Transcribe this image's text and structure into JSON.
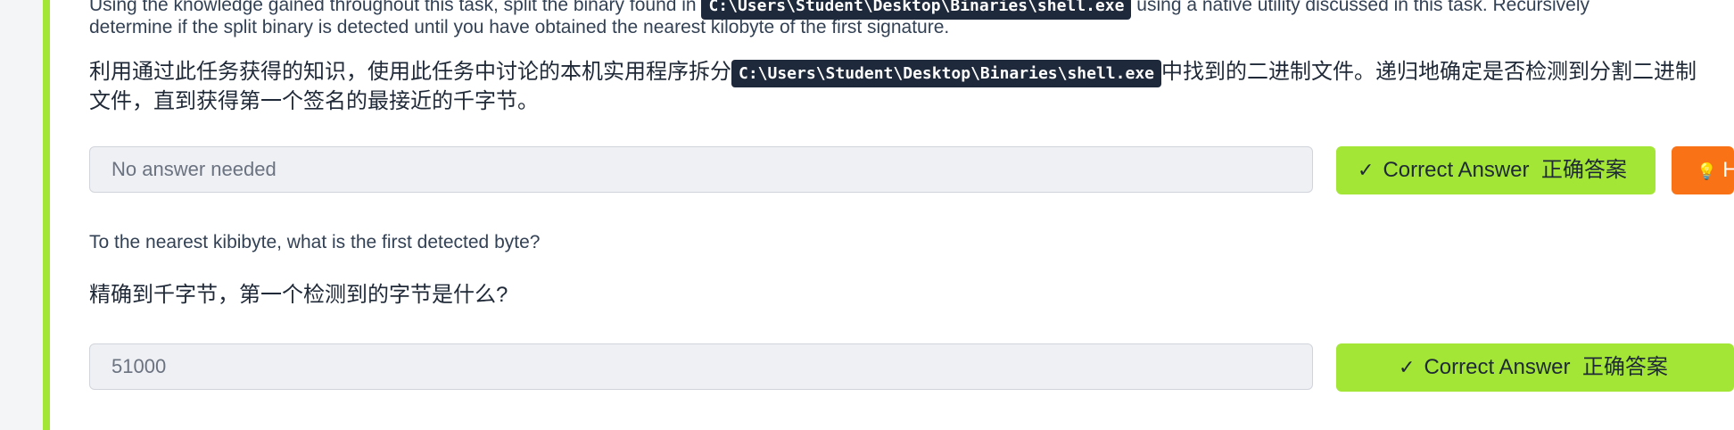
{
  "question1": {
    "text_en_line1_before": "Using the knowledge gained throughout this task, split the binary found in",
    "code": "C:\\Users\\Student\\Desktop\\Binaries\\shell.exe",
    "text_en_line1_after": "using a native utility discussed in this task. Recursively",
    "text_en_line2": "determine if the split binary is detected until you have obtained the nearest kilobyte of the first signature.",
    "text_cn_line1_before": "利用通过此任务获得的知识，使用此任务中讨论的本机实用程序拆分",
    "text_cn_line1_after": "中找到的二进制文件。递归地确定是否检测到分割二进制",
    "text_cn_line2": "文件，直到获得第一个签名的最接近的千字节。",
    "answer_placeholder": "No answer needed",
    "button_label_en": "Correct Answer",
    "button_label_cn": "正确答案",
    "hint_label": "H"
  },
  "question2": {
    "text_en": "To the nearest kibibyte, what is the first detected byte?",
    "text_cn": "精确到千字节，第一个检测到的字节是什么?",
    "answer_value": "51000",
    "button_label_en": "Correct Answer",
    "button_label_cn": "正确答案"
  },
  "icons": {
    "check": "check-icon",
    "hint": "lightbulb-icon"
  },
  "colors": {
    "accent": "#a3e635",
    "hint_button": "#f97316",
    "code_bg": "#1e293b"
  }
}
